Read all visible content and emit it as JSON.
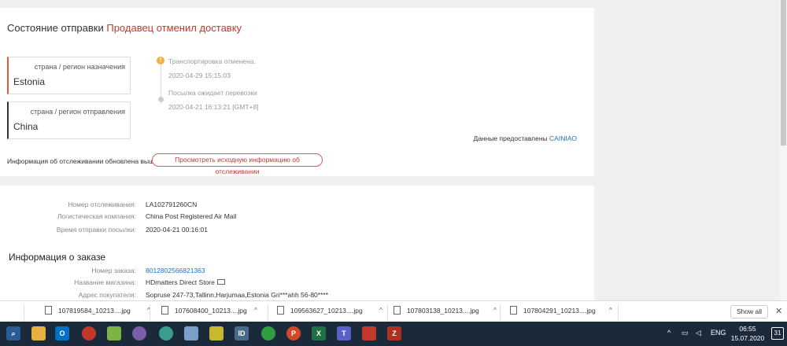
{
  "status": {
    "label": "Состояние отправки",
    "value": "Продавец отменил доставку"
  },
  "destination": {
    "label": "страна / регион назначения",
    "country": "Estonia"
  },
  "origin": {
    "label": "страна / регион отправления",
    "country": "China"
  },
  "timeline": [
    {
      "text": "Транспортировка отменена.",
      "time": "2020-04-29 15:15:03"
    },
    {
      "text": "Посылка ожидает перевозки",
      "time": "2020-04-21 16:13:21 [GMT+8]"
    }
  ],
  "source": {
    "label": "Данные предоставлены",
    "provider": "CAINIAO"
  },
  "tracking_updated": {
    "text": "Информация об отслеживании обновлена выше",
    "button": "Просмотреть исходную информацию об отслеживании"
  },
  "shipment": {
    "tracking_label": "Номер отслеживания:",
    "tracking_value": "LA102791260CN",
    "logistics_label": "Логистическая компания:",
    "logistics_value": "China Post Registered Air Mail",
    "shipped_label": "Время отправки посылки:",
    "shipped_value": "2020-04-21 00:16:01"
  },
  "order": {
    "title": "Информация о заказе",
    "number_label": "Номер заказа:",
    "number_value": "8012802566821363",
    "store_label": "Название магазина:",
    "store_value": "HDmatters Direct Store",
    "address_label": "Адрес покупателя:",
    "address_value": "Sopruse 247-73,Tallinn,Harjumaa,Estonia Gri***ahh 56-80****"
  },
  "downloads": [
    {
      "name": "107819584_10213....jpg"
    },
    {
      "name": "107608400_10213....jpg"
    },
    {
      "name": "109563627_10213....jpg"
    },
    {
      "name": "107803138_10213....jpg"
    },
    {
      "name": "107804291_10213....jpg"
    }
  ],
  "show_all": "Show all",
  "taskbar": {
    "language": "ENG",
    "time": "06:55",
    "date": "15.07.2020",
    "notifications": "31"
  }
}
